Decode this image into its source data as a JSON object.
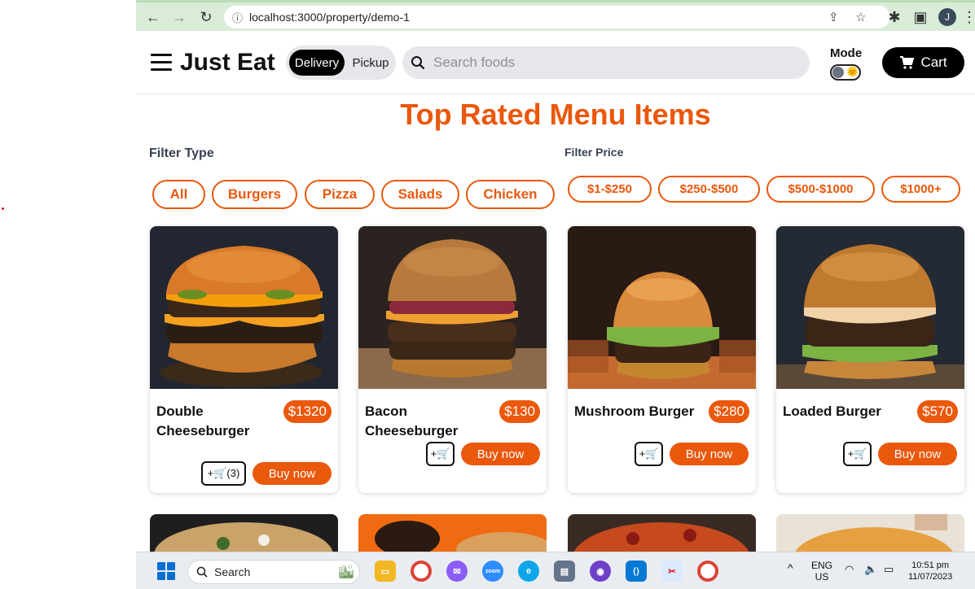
{
  "browser": {
    "url": "localhost:3000/property/demo-1",
    "profile_initial": "J"
  },
  "header": {
    "brand": "Just Eat",
    "mode_options": [
      "Delivery",
      "Pickup"
    ],
    "search_placeholder": "Search foods",
    "mode_label": "Mode",
    "cart_label": "Cart"
  },
  "page": {
    "title": "Top Rated Menu Items",
    "filter_type_label": "Filter Type",
    "filter_price_label": "Filter Price",
    "type_filters": [
      "All",
      "Burgers",
      "Pizza",
      "Salads",
      "Chicken"
    ],
    "price_filters": [
      "$1-$250",
      "$250-$500",
      "$500-$1000",
      "$1000+"
    ]
  },
  "items": [
    {
      "name": "Double Cheeseburger",
      "price": "$1320",
      "cart_label": "+🛒(3)",
      "buy_label": "Buy now"
    },
    {
      "name": "Bacon Cheeseburger",
      "price": "$130",
      "cart_label": "+🛒",
      "buy_label": "Buy now"
    },
    {
      "name": "Mushroom Burger",
      "price": "$280",
      "cart_label": "+🛒",
      "buy_label": "Buy now"
    },
    {
      "name": "Loaded Burger",
      "price": "$570",
      "cart_label": "+🛒",
      "buy_label": "Buy now"
    }
  ],
  "taskbar": {
    "search_label": "Search",
    "lang_top": "ENG",
    "lang_bottom": "US",
    "time": "10:51 pm",
    "date": "11/07/2023"
  },
  "colors": {
    "accent": "#ea580c",
    "dark": "#000000",
    "chip_bg": "#e5e7eb"
  }
}
